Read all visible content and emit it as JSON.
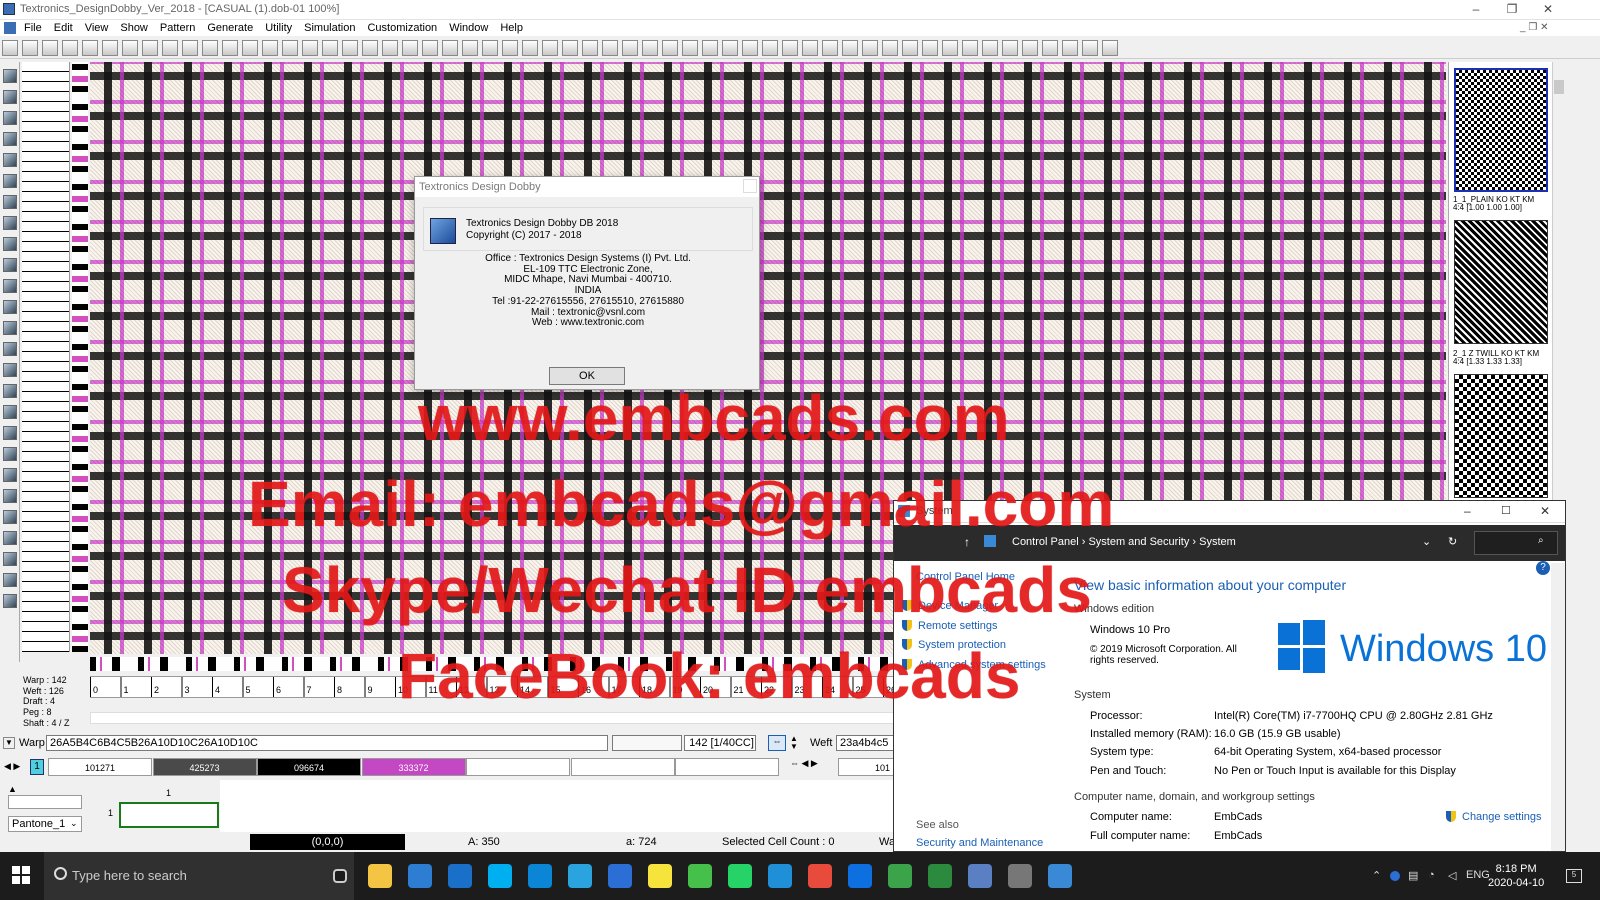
{
  "app": {
    "title": "Textronics_DesignDobby_Ver_2018 - [CASUAL (1).dob-01 100%]",
    "window_controls": {
      "minimize": "–",
      "restore": "❐",
      "close": "✕"
    }
  },
  "menu": [
    "File",
    "Edit",
    "View",
    "Show",
    "Pattern",
    "Generate",
    "Utility",
    "Simulation",
    "Customization",
    "Window",
    "Help"
  ],
  "right_panel": {
    "weaves": [
      {
        "label_line1": "1_1_PLAIN KO KT KM",
        "label_line2": "4:4 [1.00 1.00 1.00]"
      },
      {
        "label_line1": "2_1 Z TWILL KO KT KM",
        "label_line2": "4:4 [1.33 1.33 1.33]"
      }
    ]
  },
  "stats": {
    "warp": "Warp : 142",
    "weft": "Weft : 126",
    "draft": "Draft : 4",
    "peg": "Peg : 8",
    "shaft": "Shaft : 4 / Z"
  },
  "ruler_numbers": [
    "0",
    "1",
    "2",
    "3",
    "4",
    "5",
    "6",
    "7",
    "8",
    "9",
    "10",
    "11",
    "12",
    "13",
    "14",
    "15",
    "16",
    "17",
    "18",
    "19",
    "20",
    "21",
    "22",
    "23",
    "24",
    "25",
    "26"
  ],
  "warp_row": {
    "label": "Warp",
    "code": "26A5B4C6B4C5B26A10D10C26A10D10C",
    "count": "142 [1/40CC]",
    "weft_label": "Weft",
    "weft_code": "23a4b4c5"
  },
  "palette": {
    "active_index": "1",
    "swatches": [
      {
        "code": "101271",
        "color": "#ffffff",
        "text": "#000"
      },
      {
        "code": "425273",
        "color": "#4a4a4a",
        "text": "#fff"
      },
      {
        "code": "096674",
        "color": "#000000",
        "text": "#fff"
      },
      {
        "code": "333372",
        "color": "#c447c4",
        "text": "#fff"
      },
      {
        "code": "",
        "color": "#ffffff",
        "text": "#000"
      },
      {
        "code": "",
        "color": "#ffffff",
        "text": "#000"
      },
      {
        "code": "",
        "color": "#ffffff",
        "text": "#000"
      }
    ],
    "right_swatch": "101"
  },
  "bottom": {
    "pantone_select": "Pantone_1",
    "col_header": "1",
    "row_header": "1"
  },
  "status": {
    "coords": "(0,0,0)",
    "a_upper": "A: 350",
    "a_lower": "a: 724",
    "selected": "Selected Cell Count : 0",
    "extra": "Wa"
  },
  "dialog": {
    "title": "Textronics Design Dobby",
    "product": "Textronics Design Dobby DB 2018",
    "copyright": "Copyright (C) 2017 - 2018",
    "address": [
      "Office : Textronics Design Systems (I) Pvt. Ltd.",
      "EL-109 TTC Electronic Zone,",
      "MIDC Mhape, Navi Mumbai - 400710.",
      "INDIA",
      "Tel :91-22-27615556, 27615510, 27615880",
      "Mail : textronic@vsnl.com",
      "Web : www.textronic.com"
    ],
    "ok": "OK"
  },
  "watermark": {
    "line1": "www.embcads.com",
    "line2": "Email: embcads@gmail.com",
    "line3": "Skype/Wechat ID embcads",
    "line4": "FaceBook: embcads"
  },
  "system_window": {
    "title": "System",
    "breadcrumbs": [
      "Control Panel",
      "System and Security",
      "System"
    ],
    "left_links": {
      "home": "Control Panel Home",
      "items": [
        "Device Manager",
        "Remote settings",
        "System protection",
        "Advanced system settings"
      ],
      "see_also": "See also",
      "security": "Security and Maintenance"
    },
    "heading": "View basic information about your computer",
    "windows_edition": "Windows edition",
    "edition": "Windows 10 Pro",
    "copyright": "© 2019 Microsoft Corporation. All rights reserved.",
    "logo_text": "Windows 10",
    "system_section": "System",
    "specs": [
      {
        "label": "Processor:",
        "value": "Intel(R) Core(TM) i7-7700HQ CPU @ 2.80GHz   2.81 GHz"
      },
      {
        "label": "Installed memory (RAM):",
        "value": "16.0 GB (15.9 GB usable)"
      },
      {
        "label": "System type:",
        "value": "64-bit Operating System, x64-based processor"
      },
      {
        "label": "Pen and Touch:",
        "value": "No Pen or Touch Input is available for this Display"
      }
    ],
    "name_section": "Computer name, domain, and workgroup settings",
    "computer_name_label": "Computer name:",
    "computer_name": "EmbCads",
    "full_name_label": "Full computer name:",
    "full_name": "EmbCads",
    "change_settings": "Change settings",
    "help": "?"
  },
  "taskbar": {
    "search_placeholder": "Type here to search",
    "time": "8:18 PM",
    "date": "2020-04-10",
    "lang": "ENG",
    "apps": [
      {
        "name": "task-view-icon",
        "color": "#1c1c1c"
      },
      {
        "name": "file-explorer-icon",
        "color": "#f4c542"
      },
      {
        "name": "store-icon",
        "color": "#2d7dd2"
      },
      {
        "name": "mail-icon",
        "color": "#1a6fc9"
      },
      {
        "name": "skype-icon",
        "color": "#00aff0"
      },
      {
        "name": "skype-alt-icon",
        "color": "#0b86d6"
      },
      {
        "name": "telegram-icon",
        "color": "#2aa3df"
      },
      {
        "name": "imo-icon",
        "color": "#2b6fd6"
      },
      {
        "name": "kakaotalk-icon",
        "color": "#f6e33b"
      },
      {
        "name": "wechat-icon",
        "color": "#45c04b"
      },
      {
        "name": "whatsapp-icon",
        "color": "#25d366"
      },
      {
        "name": "edge-icon",
        "color": "#1f8fd8"
      },
      {
        "name": "chrome-icon",
        "color": "#e84a3c"
      },
      {
        "name": "teamviewer-icon",
        "color": "#0e6fe0"
      },
      {
        "name": "camtasia-icon",
        "color": "#3ba44a"
      },
      {
        "name": "coreldraw-icon",
        "color": "#2b8a3e"
      },
      {
        "name": "dobby-app-icon",
        "color": "#5a7fc2"
      },
      {
        "name": "film-app-icon",
        "color": "#777777"
      },
      {
        "name": "control-panel-icon",
        "color": "#3a89d6"
      }
    ]
  }
}
